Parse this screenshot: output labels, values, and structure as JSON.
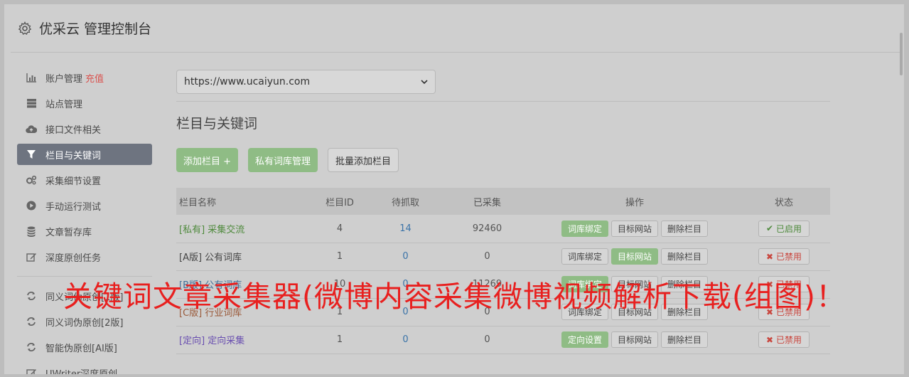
{
  "header": {
    "title": "优采云 管理控制台",
    "icon": "gear-icon"
  },
  "sidebar": {
    "items": [
      {
        "label": "账户管理",
        "extra": "充值",
        "icon": "bar-chart-icon"
      },
      {
        "label": "站点管理",
        "icon": "server-icon"
      },
      {
        "label": "接口文件相关",
        "icon": "cloud-upload-icon"
      },
      {
        "label": "栏目与关键词",
        "icon": "filter-icon",
        "active": true
      },
      {
        "label": "采集细节设置",
        "icon": "gears-icon"
      },
      {
        "label": "手动运行测试",
        "icon": "play-icon"
      },
      {
        "label": "文章暂存库",
        "icon": "database-icon"
      },
      {
        "label": "深度原创任务",
        "icon": "edit-icon"
      }
    ],
    "items2": [
      {
        "label": "同义词伪原创[1版]",
        "icon": "refresh-icon"
      },
      {
        "label": "同义词伪原创[2版]",
        "icon": "refresh-icon"
      },
      {
        "label": "智能伪原创[AI版]",
        "icon": "refresh-icon"
      },
      {
        "label": "UWriter深度原创",
        "icon": "edit-icon"
      }
    ]
  },
  "main": {
    "site_select": "https://www.ucaiyun.com",
    "section_title": "栏目与关键词",
    "buttons": {
      "add": "添加栏目 +",
      "private": "私有词库管理",
      "batch": "批量添加栏目"
    },
    "table": {
      "headers": {
        "name": "栏目名称",
        "id": "栏目ID",
        "pending": "待抓取",
        "collected": "已采集",
        "ops": "操作",
        "status": "状态"
      },
      "rows": [
        {
          "name": "[私有] 采集交流",
          "id": "4",
          "pending": "14",
          "collected": "92460",
          "op1": "词库绑定",
          "op2": "目标网站",
          "op3": "删除栏目",
          "status": "已启用"
        },
        {
          "name": "[A版] 公有词库",
          "id": "1",
          "pending": "0",
          "collected": "0",
          "op1": "词库绑定",
          "op2": "目标网站",
          "op3": "删除栏目",
          "status": "已禁用"
        },
        {
          "name": "[B版] 公有词库",
          "id": "10",
          "pending": "0",
          "collected": "11269",
          "op1": "词库绑定",
          "op2": "目标网站",
          "op3": "删除栏目",
          "status": "已禁用"
        },
        {
          "name": "[C版] 行业词库",
          "id": "1",
          "pending": "0",
          "collected": "0",
          "op1": "词库绑定",
          "op2": "目标网站",
          "op3": "删除栏目",
          "status": "已禁用"
        },
        {
          "name": "[定向] 定向采集",
          "id": "1",
          "pending": "0",
          "collected": "0",
          "op1": "定向设置",
          "op2": "目标网站",
          "op3": "删除栏目",
          "status": "已禁用"
        }
      ]
    }
  },
  "overlay": {
    "text": "关键词文章采集器(微博内容采集微博视频解析下载(组图)！"
  },
  "colors": {
    "accent_green": "#8fbc85",
    "sidebar_active": "#6e7480",
    "overlay_red": "#e8201f",
    "danger": "#c9473f"
  }
}
